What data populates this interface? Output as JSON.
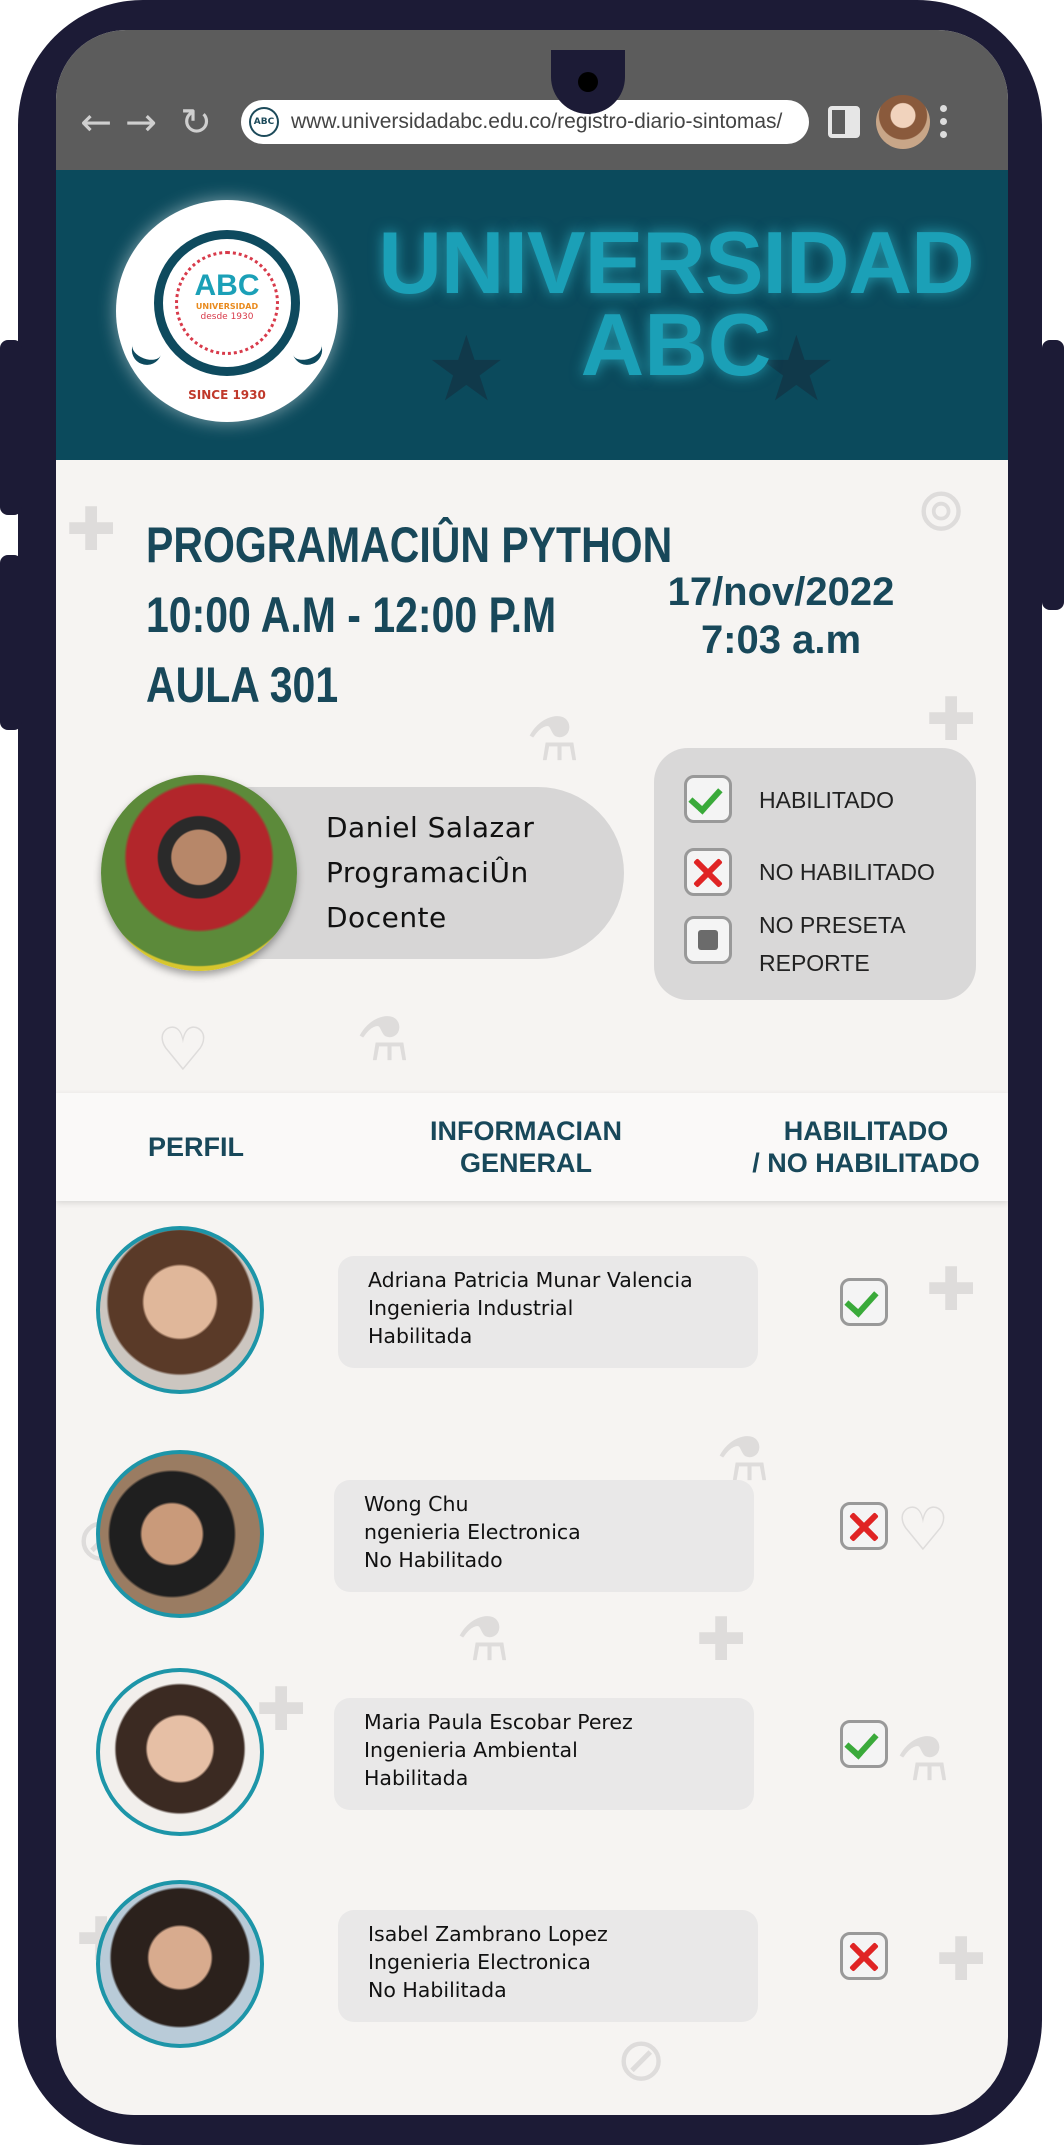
{
  "browser": {
    "url": "www.universidadabc.edu.co/registro-diario-sintomas/",
    "back_icon": "arrow-left-icon",
    "forward_icon": "arrow-right-icon",
    "reload_icon": "reload-icon"
  },
  "header": {
    "title_line1": "UNIVERSIDAD",
    "title_line2": "ABC",
    "logo": {
      "name": "ABC",
      "sub": "UNIVERSIDAD",
      "desde": "desde 1930",
      "since": "SINCE 1930"
    }
  },
  "course": {
    "name": "PROGRAMACIÛN PYTHON",
    "schedule": "10:00 A.M - 12:00 P.M",
    "room": "AULA 301"
  },
  "datetime": {
    "date": "17/nov/2022",
    "time": "7:03 a.m"
  },
  "teacher": {
    "name": "Daniel Salazar",
    "subject": "ProgramaciÛn",
    "role": "Docente"
  },
  "legend": {
    "enabled": "HABILITADO",
    "disabled": "NO HABILITADO",
    "no_report_1": "NO PRESETA",
    "no_report_2": "REPORTE"
  },
  "table": {
    "col_profile": "PERFIL",
    "col_info_1": "INFORMACIAN",
    "col_info_2": "GENERAL",
    "col_status_1": "HABILITADO",
    "col_status_2": "/ NO HABILITADO",
    "rows": [
      {
        "name": "Adriana Patricia Munar Valencia",
        "program": "Ingenieria Industrial",
        "status": "Habilitada",
        "enabled": true
      },
      {
        "name": "Wong Chu",
        "program": "ngenieria Electronica",
        "status": "No Habilitado",
        "enabled": false
      },
      {
        "name": "Maria Paula Escobar Perez",
        "program": "Ingenieria Ambiental",
        "status": "Habilitada",
        "enabled": true
      },
      {
        "name": "Isabel Zambrano Lopez",
        "program": "Ingenieria Electronica",
        "status": "No Habilitada",
        "enabled": false
      }
    ]
  },
  "colors": {
    "primary": "#0b4a5c",
    "accent": "#1ba0b7",
    "text_dark": "#18485a",
    "ok": "#3aaa3a",
    "bad": "#e02424"
  }
}
